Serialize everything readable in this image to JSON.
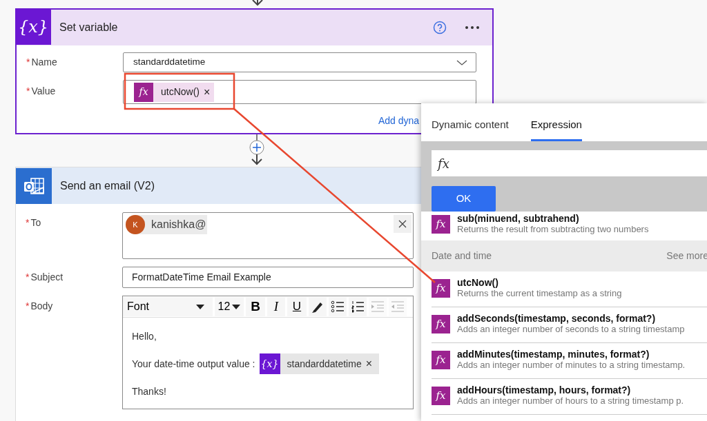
{
  "set_variable": {
    "icon": "{x}",
    "title": "Set variable",
    "fields": [
      {
        "mark": "*",
        "label": "Name",
        "kind": "dropdown",
        "value": "standarddatetime"
      },
      {
        "mark": "*",
        "label": "Value",
        "kind": "tokens",
        "tokens": [
          {
            "icon": "fx",
            "text": "utcNow()",
            "remove": "×"
          }
        ]
      }
    ],
    "link": "Add dyna"
  },
  "send_email": {
    "title": "Send an email (V2)",
    "fields": [
      {
        "mark": "*",
        "label": "To",
        "kind": "recipients",
        "recipients": [
          {
            "initial": "K",
            "text": "kanishka@"
          }
        ]
      },
      {
        "mark": "*",
        "label": "Subject",
        "kind": "text",
        "value": "FormatDateTime Email Example"
      },
      {
        "mark": "*",
        "label": "Body",
        "kind": "editor",
        "toolbar": {
          "font": "Font",
          "size": "12",
          "bold": "B",
          "italic": "I",
          "underline": "U",
          "tools": [
            {
              "kind": "highlight",
              "disabled": false
            },
            {
              "kind": "bullets",
              "disabled": false
            },
            {
              "kind": "numbering",
              "disabled": false
            },
            {
              "kind": "indent",
              "disabled": true
            },
            {
              "kind": "outdent",
              "disabled": true
            }
          ]
        },
        "lines": [
          {
            "text": "Hello,"
          },
          {
            "text": "Your date-time output value :",
            "token": {
              "icon": "{x}",
              "text": "standarddatetime",
              "remove": "×"
            }
          },
          {
            "text": "Thanks!"
          }
        ]
      }
    ]
  },
  "expression_panel": {
    "tabs": [
      {
        "label": "Dynamic content",
        "selected": false
      },
      {
        "label": "Expression",
        "selected": true
      }
    ],
    "input_icon": "fx",
    "ok": "OK",
    "functions": [
      {
        "icon": "fx",
        "name": "sub(minuend, subtrahend)",
        "description": "Returns the result from subtracting two numbers"
      }
    ],
    "section": {
      "title": "Date and time",
      "link": "See more"
    },
    "section_functions": [
      {
        "icon": "fx",
        "name": "utcNow()",
        "description": "Returns the current timestamp as a string"
      },
      {
        "icon": "fx",
        "name": "addSeconds(timestamp, seconds, format?)",
        "description": "Adds an integer number of seconds to a string timestamp"
      },
      {
        "icon": "fx",
        "name": "addMinutes(timestamp, minutes, format?)",
        "description": "Adds an integer number of minutes to a string timestamp."
      },
      {
        "icon": "fx",
        "name": "addHours(timestamp, hours, format?)",
        "description": "Adds an integer number of hours to a string timestamp p."
      }
    ]
  }
}
